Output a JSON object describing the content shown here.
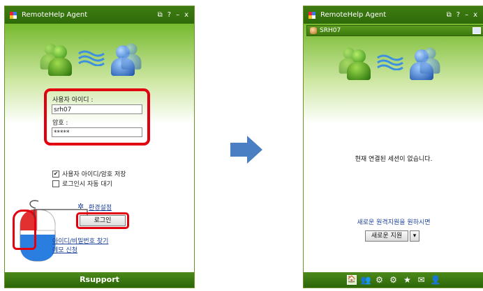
{
  "app": {
    "title": "RemoteHelp Agent",
    "brand": "Rsupport"
  },
  "titlebar_buttons": [
    {
      "icon": "restore-icon",
      "glyph": "⧉"
    },
    {
      "icon": "help-icon",
      "glyph": "?"
    },
    {
      "icon": "minimize-icon",
      "glyph": "–"
    },
    {
      "icon": "close-icon",
      "glyph": "x"
    }
  ],
  "login": {
    "user_id_label": "사용자 아이디 :",
    "user_id_value": "srh07",
    "password_label": "암호 :",
    "password_value": "*****",
    "save_checkbox": {
      "label": "사용자 아이디/암호 저장",
      "checked": true
    },
    "autowait_checkbox": {
      "label": "로그인시 자동 대기",
      "checked": false
    },
    "settings_link": "환경설정",
    "login_button": "로그인",
    "find_link": "아이디/비밀번호 찾기",
    "demo_link": "데모 신청"
  },
  "session": {
    "user_name": "SRH07",
    "no_session_text": "현재 연결된 세션이 없습니다.",
    "new_support_prompt": "새로운 원격지원을 원하시면",
    "new_support_button": "새로운 지원",
    "dropdown_glyph": "▾"
  },
  "toolbar_icons": [
    {
      "name": "home-icon",
      "glyph": "🏠"
    },
    {
      "name": "users-icon",
      "glyph": "👥"
    },
    {
      "name": "settings-icon",
      "glyph": "⚙"
    },
    {
      "name": "tools-icon",
      "glyph": "⚙"
    },
    {
      "name": "favorite-icon",
      "glyph": "★"
    },
    {
      "name": "message-icon",
      "glyph": "✉"
    },
    {
      "name": "user-status-icon",
      "glyph": "👤"
    }
  ],
  "colors": {
    "brand_green": "#3f7c12",
    "highlight_red": "#e00010",
    "arrow_blue": "#4a7fc4"
  }
}
